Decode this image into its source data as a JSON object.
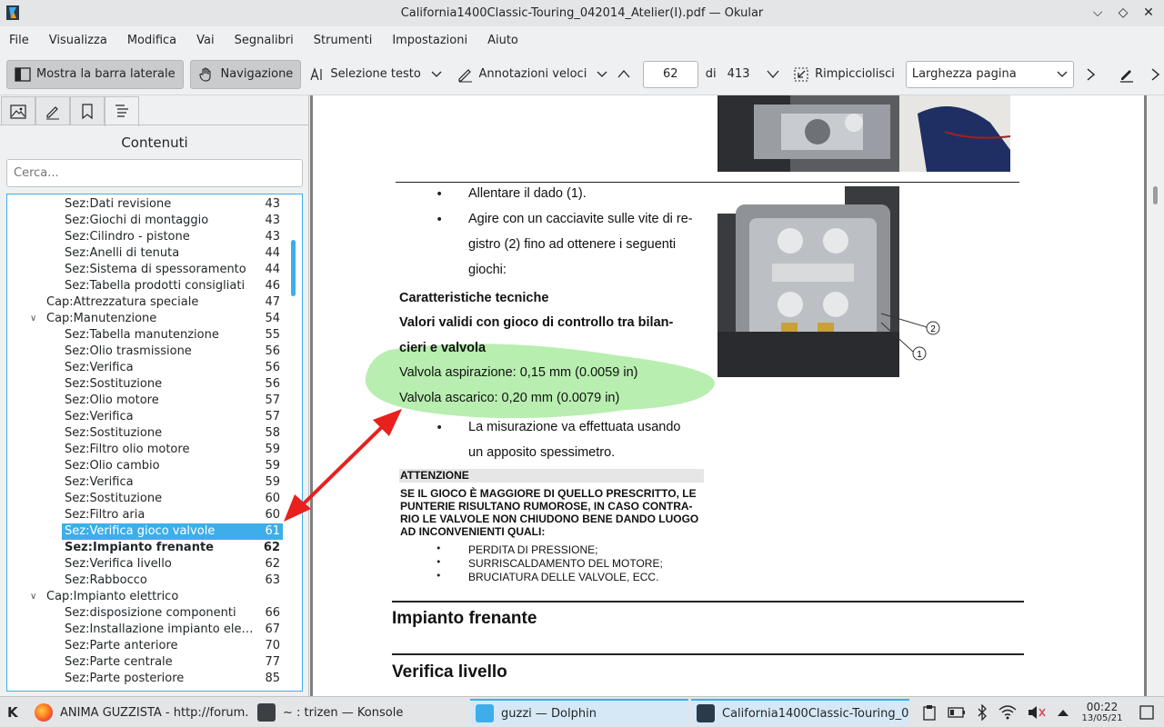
{
  "window": {
    "title": "California1400Classic-Touring_042014_Atelier(I).pdf — Okular",
    "controls": [
      "minimize",
      "maximize",
      "close"
    ]
  },
  "menubar": [
    "File",
    "Visualizza",
    "Modifica",
    "Vai",
    "Segnalibri",
    "Strumenti",
    "Impostazioni",
    "Aiuto"
  ],
  "toolbar": {
    "sidebar_toggle": "Mostra la barra laterale",
    "browse": "Navigazione",
    "text_select": "Selezione testo",
    "quick_annotations": "Annotazioni veloci",
    "page_current": "62",
    "page_of": "di",
    "page_total": "413",
    "zoom_out": "Rimpicciolisci",
    "zoom_mode": "Larghezza pagina"
  },
  "sidebar": {
    "title": "Contenuti",
    "search_placeholder": "Cerca...",
    "tabs": [
      "thumbnails-icon",
      "annotations-icon",
      "bookmarks-icon",
      "contents-icon"
    ],
    "items": [
      {
        "label": "Sez:Dati revisione",
        "page": "43",
        "level": 2
      },
      {
        "label": "Sez:Giochi di montaggio",
        "page": "43",
        "level": 2
      },
      {
        "label": "Sez:Cilindro - pistone",
        "page": "43",
        "level": 2
      },
      {
        "label": "Sez:Anelli di tenuta",
        "page": "44",
        "level": 2
      },
      {
        "label": "Sez:Sistema di spessoramento",
        "page": "44",
        "level": 2
      },
      {
        "label": "Sez:Tabella prodotti consigliati",
        "page": "46",
        "level": 2
      },
      {
        "label": "Cap:Attrezzatura speciale",
        "page": "47",
        "level": 1
      },
      {
        "label": "Cap:Manutenzione",
        "page": "54",
        "level": 1,
        "expanded": true
      },
      {
        "label": "Sez:Tabella manutenzione",
        "page": "55",
        "level": 2
      },
      {
        "label": "Sez:Olio trasmissione",
        "page": "56",
        "level": 2
      },
      {
        "label": "Sez:Verifica",
        "page": "56",
        "level": 2
      },
      {
        "label": "Sez:Sostituzione",
        "page": "56",
        "level": 2
      },
      {
        "label": "Sez:Olio motore",
        "page": "57",
        "level": 2
      },
      {
        "label": "Sez:Verifica",
        "page": "57",
        "level": 2
      },
      {
        "label": "Sez:Sostituzione",
        "page": "58",
        "level": 2
      },
      {
        "label": "Sez:Filtro olio motore",
        "page": "59",
        "level": 2
      },
      {
        "label": "Sez:Olio cambio",
        "page": "59",
        "level": 2
      },
      {
        "label": "Sez:Verifica",
        "page": "59",
        "level": 2
      },
      {
        "label": "Sez:Sostituzione",
        "page": "60",
        "level": 2
      },
      {
        "label": "Sez:Filtro aria",
        "page": "60",
        "level": 2
      },
      {
        "label": "Sez:Verifica gioco valvole",
        "page": "61",
        "level": 2,
        "selected": true
      },
      {
        "label": "Sez:Impianto frenante",
        "page": "62",
        "level": 2,
        "bold": true
      },
      {
        "label": "Sez:Verifica livello",
        "page": "62",
        "level": 2
      },
      {
        "label": "Sez:Rabbocco",
        "page": "63",
        "level": 2
      },
      {
        "label": "Cap:Impianto elettrico",
        "page": "",
        "level": 1,
        "expanded": true
      },
      {
        "label": "Sez:disposizione componenti",
        "page": "66",
        "level": 2
      },
      {
        "label": "Sez:Installazione impianto elettri...",
        "page": "67",
        "level": 2
      },
      {
        "label": "Sez:Parte anteriore",
        "page": "70",
        "level": 2
      },
      {
        "label": "Sez:Parte centrale",
        "page": "77",
        "level": 2
      },
      {
        "label": "Sez:Parte posteriore",
        "page": "85",
        "level": 2
      }
    ]
  },
  "document": {
    "bullets_top": [
      "Allentare il dado (1).",
      "Agire con un cacciavite sulle vite di re-",
      "gistro (2) fino ad ottenere i seguenti",
      "giochi:"
    ],
    "specs_title": "Caratteristiche tecniche",
    "specs_line1": "Valori validi con gioco di controllo tra bilan-",
    "specs_line2": "cieri e valvola",
    "valve_intake": "Valvola aspirazione: 0,15 mm (0.0059 in)",
    "valve_exhaust": "Valvola ascarico: 0,20 mm (0.0079 in)",
    "bullet_measure_1": "La misurazione va effettuata usando",
    "bullet_measure_2": "un apposito spessimetro.",
    "attention_title": "ATTENZIONE",
    "attention_lines": [
      "SE IL GIOCO È MAGGIORE DI QUELLO PRESCRITTO, LE",
      "PUNTERIE RISULTANO RUMOROSE, IN CASO CONTRA-",
      "RIO LE VALVOLE NON CHIUDONO BENE DANDO LUOGO",
      "AD INCONVENIENTI QUALI:"
    ],
    "attention_bullets": [
      "PERDITA DI PRESSIONE;",
      "SURRISCALDAMENTO DEL MOTORE;",
      "BRUCIATURA DELLE VALVOLE, ECC."
    ],
    "callout_1": "1",
    "callout_2": "2",
    "heading_brakes": "Impianto frenante",
    "heading_level": "Verifica livello",
    "highlight_color": "#b8eeb0",
    "arrow_color": "#e8201e"
  },
  "taskbar": {
    "tasks": [
      "ANIMA GUZZISTA - http://forum...",
      "~ : trizen — Konsole",
      "guzzi — Dolphin",
      "California1400Classic-Touring_0..."
    ],
    "time": "00:22",
    "date": "13/05/21"
  }
}
